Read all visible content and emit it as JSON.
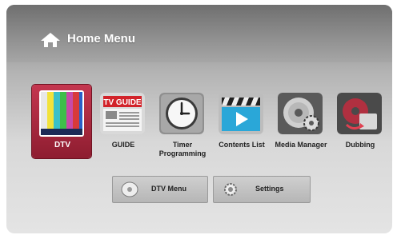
{
  "header": {
    "title": "Home Menu",
    "icon": "home-icon"
  },
  "menu": {
    "items": [
      {
        "label": "DTV",
        "icon": "tv-color-bars-icon",
        "selected": true
      },
      {
        "label": "GUIDE",
        "icon": "tv-guide-icon",
        "badge": "TV GUIDE"
      },
      {
        "label": "Timer Programming",
        "icon": "clock-icon"
      },
      {
        "label": "Contents List",
        "icon": "clapperboard-play-icon"
      },
      {
        "label": "Media Manager",
        "icon": "disc-gear-icon"
      },
      {
        "label": "Dubbing",
        "icon": "disc-copy-icon"
      }
    ]
  },
  "submenu": {
    "dtv_menu": {
      "label": "DTV Menu",
      "icon": "disc-icon"
    },
    "settings": {
      "label": "Settings",
      "icon": "gear-icon"
    }
  },
  "colors": {
    "selected": "#b02a40",
    "header": "#8a8a8a"
  }
}
